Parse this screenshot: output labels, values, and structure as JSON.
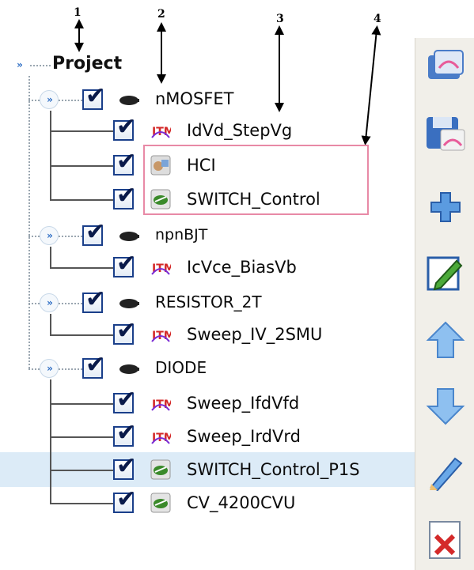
{
  "callouts": [
    "1",
    "2",
    "3",
    "4"
  ],
  "project": {
    "label": "Project"
  },
  "tree": {
    "devices": [
      {
        "label": "nMOSFET",
        "icon": "device-icon",
        "tests": [
          {
            "label": "IdVd_StepVg",
            "icon": "itm-test-icon"
          },
          {
            "label": "HCI",
            "icon": "hci-module-icon"
          },
          {
            "label": "SWITCH_Control",
            "icon": "switch-module-icon"
          }
        ]
      },
      {
        "label": "npnBJT",
        "icon": "device-icon",
        "tests": [
          {
            "label": "IcVce_BiasVb",
            "icon": "itm-test-icon"
          }
        ]
      },
      {
        "label": "RESISTOR_2T",
        "icon": "device-icon",
        "tests": [
          {
            "label": "Sweep_IV_2SMU",
            "icon": "itm-test-icon"
          }
        ]
      },
      {
        "label": "DIODE",
        "icon": "device-icon",
        "tests": [
          {
            "label": "Sweep_IfdVfd",
            "icon": "itm-test-icon"
          },
          {
            "label": "Sweep_IrdVrd",
            "icon": "itm-test-icon"
          },
          {
            "label": "SWITCH_Control_P1S",
            "icon": "switch-module-icon",
            "selected": true
          },
          {
            "label": "CV_4200CVU",
            "icon": "switch-module-icon"
          }
        ]
      }
    ]
  },
  "toolbar": {
    "buttons": [
      {
        "name": "open-project-icon"
      },
      {
        "name": "save-project-icon"
      },
      {
        "name": "add-icon"
      },
      {
        "name": "edit-icon"
      },
      {
        "name": "move-up-icon"
      },
      {
        "name": "move-down-icon"
      },
      {
        "name": "rename-icon"
      },
      {
        "name": "delete-icon"
      }
    ]
  },
  "colors": {
    "selection": "#dcebf7",
    "highlight_box": "#e88aa6",
    "checkbox_border": "#1a3f8a",
    "toolbar_bg": "#f1efe9"
  }
}
